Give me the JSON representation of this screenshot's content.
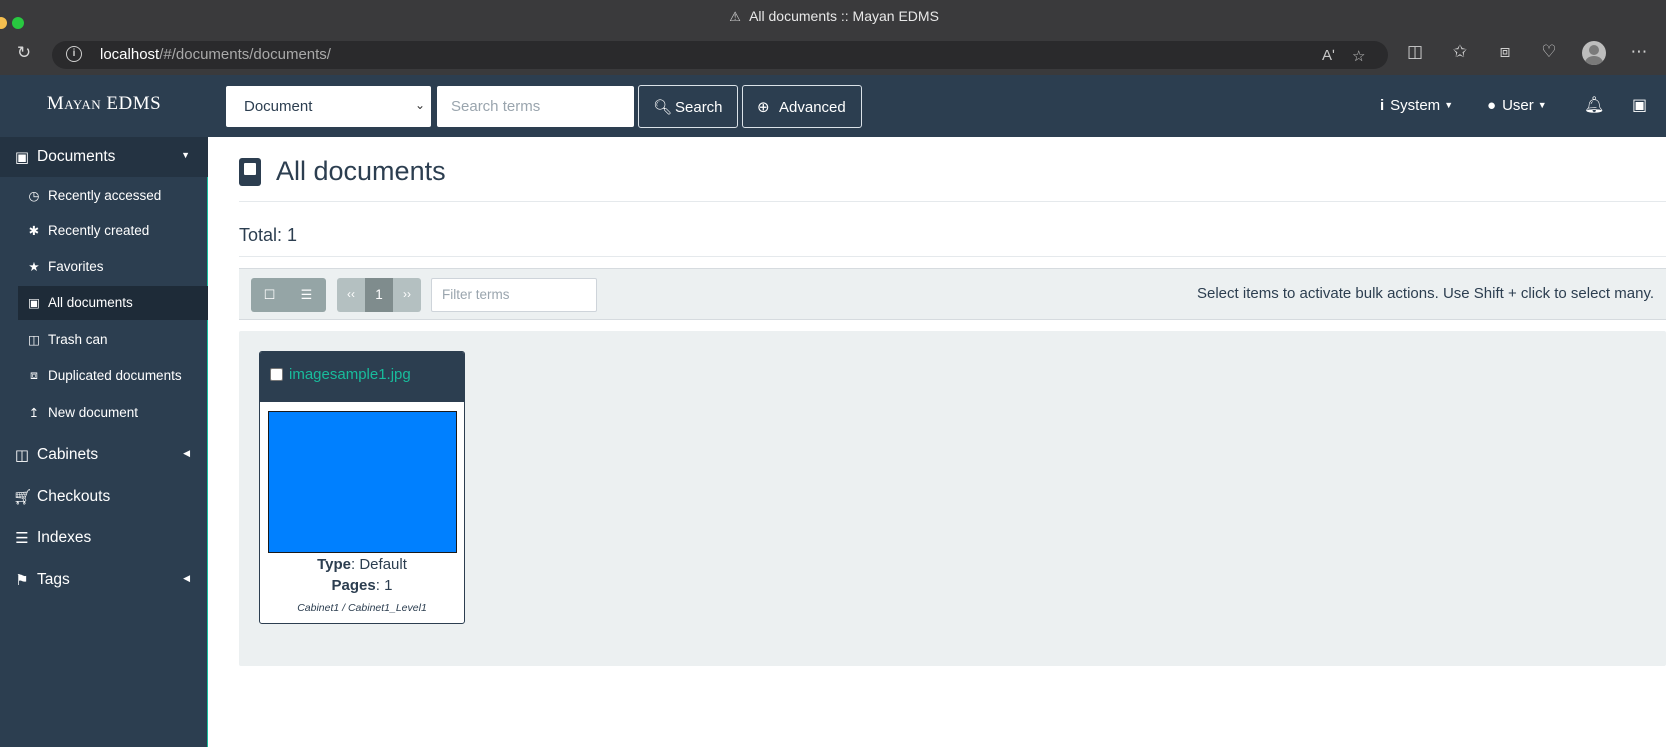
{
  "browser": {
    "window_title": "All documents :: Mayan EDMS",
    "url_host": "localhost",
    "url_path": "/#/documents/documents/",
    "read_aloud_label": "Aʹ"
  },
  "navbar": {
    "brand": "Mayan EDMS",
    "search_model": "Document",
    "search_placeholder": "Search terms",
    "search_button": "Search",
    "advanced_button": "Advanced",
    "system_label": "System",
    "user_label": "User"
  },
  "sidebar": {
    "sections": [
      {
        "label": "Documents",
        "icon": "book-icon",
        "expanded": true
      },
      {
        "label": "Cabinets",
        "icon": "columns-icon",
        "expanded": false
      },
      {
        "label": "Checkouts",
        "icon": "shopping-cart-icon",
        "expanded": false
      },
      {
        "label": "Indexes",
        "icon": "list-icon",
        "expanded": false
      },
      {
        "label": "Tags",
        "icon": "tags-icon",
        "expanded": false
      }
    ],
    "document_items": [
      {
        "label": "Recently accessed",
        "icon": "clock-icon"
      },
      {
        "label": "Recently created",
        "icon": "asterisk-icon"
      },
      {
        "label": "Favorites",
        "icon": "star-icon"
      },
      {
        "label": "All documents",
        "icon": "book-icon",
        "active": true
      },
      {
        "label": "Trash can",
        "icon": "trash-icon"
      },
      {
        "label": "Duplicated documents",
        "icon": "clone-icon"
      },
      {
        "label": "New document",
        "icon": "upload-icon"
      }
    ]
  },
  "main": {
    "title": "All documents",
    "total": "Total: 1",
    "pager": {
      "prev": "‹‹",
      "current": "1",
      "next": "››"
    },
    "filter_placeholder": "Filter terms",
    "bulk_hint": "Select items to activate bulk actions. Use Shift + click to select many."
  },
  "documents": [
    {
      "name": "imagesample1.jpg",
      "type_label": "Type",
      "type_value": ": Default",
      "pages_label": "Pages",
      "pages_value": ": 1",
      "cabinets": "Cabinet1 / Cabinet1_Level1",
      "thumbnail_color": "#0080ff"
    }
  ],
  "colors": {
    "nav_bg": "#2c3e50",
    "accent": "#18bc9c",
    "panel_bg": "#ecf0f1"
  }
}
